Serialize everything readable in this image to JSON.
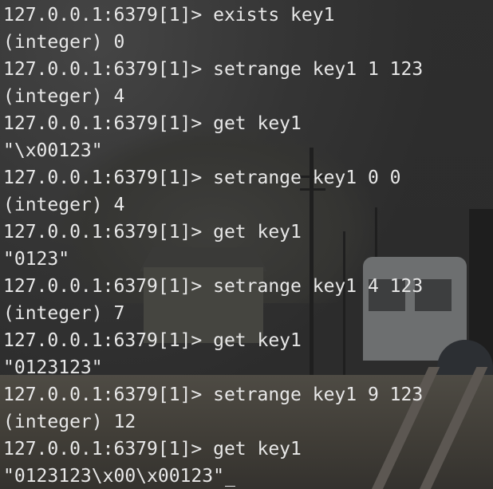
{
  "terminal": {
    "lines": [
      "127.0.0.1:6379[1]> exists key1",
      "(integer) 0",
      "127.0.0.1:6379[1]> setrange key1 1 123",
      "(integer) 4",
      "127.0.0.1:6379[1]> get key1",
      "\"\\x00123\"",
      "127.0.0.1:6379[1]> setrange key1 0 0",
      "(integer) 4",
      "127.0.0.1:6379[1]> get key1",
      "\"0123\"",
      "127.0.0.1:6379[1]> setrange key1 4 123",
      "(integer) 7",
      "127.0.0.1:6379[1]> get key1",
      "\"0123123\"",
      "127.0.0.1:6379[1]> setrange key1 9 123",
      "(integer) 12",
      "127.0.0.1:6379[1]> get key1",
      "\"0123123\\x00\\x00123\""
    ],
    "text_color": "#e8e8e8"
  }
}
